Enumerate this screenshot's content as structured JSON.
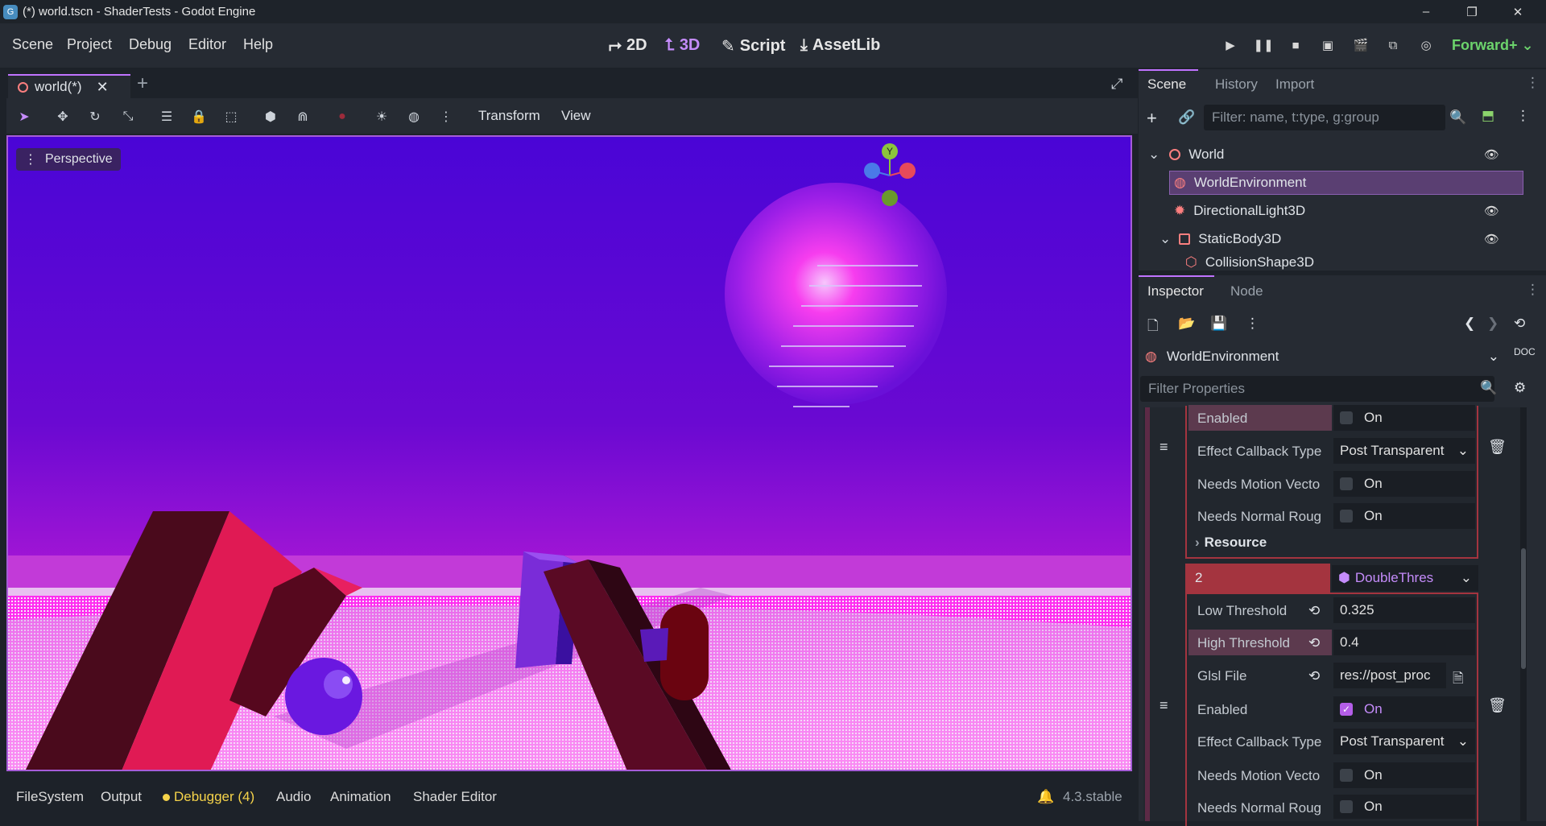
{
  "window": {
    "title": "(*) world.tscn - ShaderTests - Godot Engine",
    "logo_text": "G",
    "controls": [
      "–",
      "❐",
      "✕"
    ]
  },
  "menu": [
    "Scene",
    "Project",
    "Debug",
    "Editor",
    "Help"
  ],
  "workspaces": [
    {
      "icon": "⮣",
      "label": "2D"
    },
    {
      "icon": "⮤",
      "label": "3D"
    },
    {
      "icon": "✎",
      "label": "Script"
    },
    {
      "icon": "⤓",
      "label": "AssetLib"
    }
  ],
  "renderer": "Forward+",
  "scene_tab": {
    "label": "world(*)",
    "close": "✕",
    "add": "+"
  },
  "viewport_toolbar": {
    "transform": "Transform",
    "view": "View"
  },
  "viewport": {
    "perspective_label": "Perspective",
    "gizmo_y": "Y"
  },
  "bottom_panel": {
    "tabs": [
      "FileSystem",
      "Output",
      "Debugger (4)",
      "Audio",
      "Animation",
      "Shader Editor"
    ],
    "version": "4.3.stable",
    "accent_debugger": "#f5d34a"
  },
  "scene_dock": {
    "tabs": [
      "Scene",
      "History",
      "Import"
    ],
    "filter_placeholder": "Filter: name, t:type, g:group",
    "tree": [
      {
        "label": "World",
        "icon": "node3d-icon",
        "visible": true
      },
      {
        "label": "WorldEnvironment",
        "icon": "world-environment-icon",
        "selected": true
      },
      {
        "label": "DirectionalLight3D",
        "icon": "directional-light-icon",
        "visible": true
      },
      {
        "label": "StaticBody3D",
        "icon": "static-body-icon",
        "visible": true
      },
      {
        "label": "CollisionShape3D",
        "icon": "collision-shape-icon",
        "visible": true
      }
    ]
  },
  "inspector": {
    "tabs": [
      "Inspector",
      "Node"
    ],
    "object_name": "WorldEnvironment",
    "filter_placeholder": "Filter Properties",
    "group1": {
      "enabled_label": "Enabled",
      "enabled_value": "On",
      "callback_label": "Effect Callback Type",
      "callback_value": "Post Transparent",
      "motion_label": "Needs Motion Vecto",
      "motion_value": "On",
      "normal_label": "Needs Normal Roug",
      "normal_value": "On",
      "resource_label": "Resource"
    },
    "group2": {
      "index": "2",
      "resource_type": "DoubleThres",
      "low_label": "Low Threshold",
      "low_value": "0.325",
      "high_label": "High Threshold",
      "high_value": "0.4",
      "glsl_label": "Glsl File",
      "glsl_value": "res://post_proc",
      "enabled_label": "Enabled",
      "enabled_value": "On",
      "callback_label": "Effect Callback Type",
      "callback_value": "Post Transparent",
      "motion_label": "Needs Motion Vecto",
      "motion_value": "On",
      "normal_label": "Needs Normal Roug",
      "normal_value": "On"
    }
  },
  "colors": {
    "accent": "#c073ff",
    "selection": "#5a3f72",
    "danger_frame": "#a4343f"
  }
}
